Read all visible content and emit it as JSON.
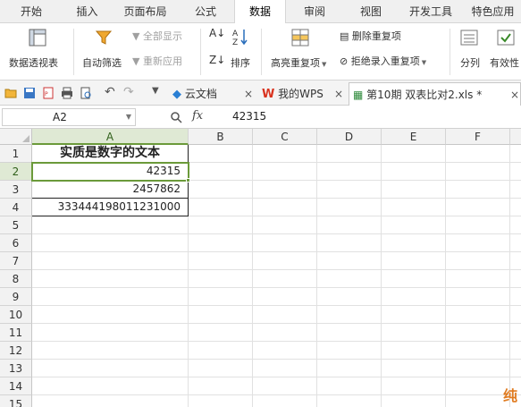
{
  "ribbon_tabs": [
    "开始",
    "插入",
    "页面布局",
    "公式",
    "数据",
    "审阅",
    "视图",
    "开发工具",
    "特色应用"
  ],
  "active_tab": "数据",
  "ribbon": {
    "pivot_table": "数据透视表",
    "auto_filter": "自动筛选",
    "show_all": "全部显示",
    "reapply": "重新应用",
    "sort": "排序",
    "highlight_duplicates": "高亮重复项",
    "delete_duplicates": "删除重复项",
    "reject_duplicates": "拒绝录入重复项",
    "split_column": "分列",
    "validity": "有效性"
  },
  "doc_tabs": [
    {
      "label": "云文档"
    },
    {
      "label": "我的WPS"
    },
    {
      "label": "第10期 双表比对2.xls *"
    }
  ],
  "formula_bar": {
    "name_box": "A2",
    "fx_label": "fx",
    "value": "42315"
  },
  "sheet": {
    "columns": [
      "A",
      "B",
      "C",
      "D",
      "E",
      "F"
    ],
    "rows": [
      "1",
      "2",
      "3",
      "4",
      "5",
      "6",
      "7",
      "8",
      "9",
      "10",
      "11",
      "12",
      "13",
      "14",
      "15"
    ],
    "cells": {
      "a1": "实质是数字的文本",
      "a2": "42315",
      "a3": "2457862",
      "a4": "333444198011231000"
    },
    "selected_cell": "A2"
  },
  "watermark": "纯",
  "colors": {
    "selection": "#6b9a3a",
    "selected_header_bg": "#dfe9d4"
  }
}
